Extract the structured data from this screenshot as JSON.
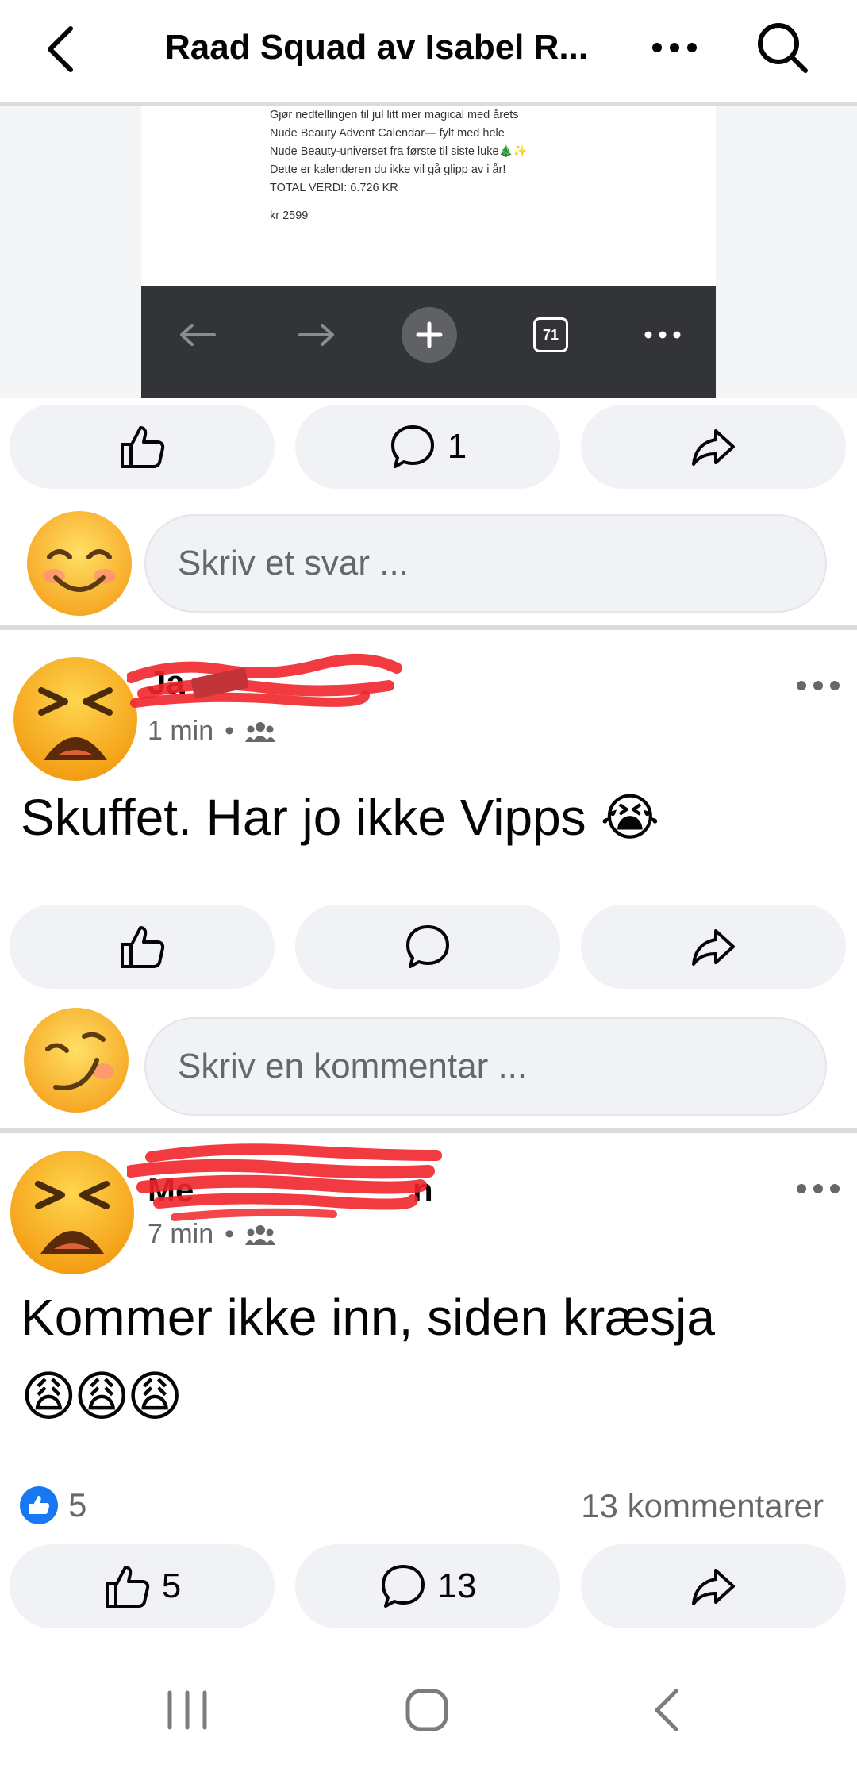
{
  "header": {
    "title": "Raad Squad av Isabel R..."
  },
  "shared_post": {
    "text_lines": [
      "Gjør nedtellingen til jul litt mer magical med årets",
      "Nude Beauty Advent Calendar— fylt med hele",
      "Nude Beauty-universet fra første til siste luke🎄✨",
      "Dette er kalenderen du ikke vil gå glipp av i år!",
      "TOTAL VERDI: 6.726 KR"
    ],
    "price": "kr 2599",
    "tab_count": "71"
  },
  "post_actions": {
    "comment_count": "1"
  },
  "reply": {
    "placeholder": "Skriv et svar ..."
  },
  "comments": [
    {
      "name_visible": "Ja",
      "time": "1 min",
      "text": "Skuffet. Har jo ikke Vipps 😭",
      "reply_placeholder": "Skriv en kommentar ..."
    },
    {
      "name_visible": "Me",
      "name_tail": "n",
      "time": "7 min",
      "text": "Kommer ikke inn, siden kræsja",
      "emojis": "😩😩😩",
      "reactions_count": "5",
      "comments_count_label": "13 kommentarer",
      "like_count": "5",
      "comment_count": "13"
    }
  ],
  "colors": {
    "like_blue": "#1877f2",
    "pill_bg": "#f0f2f5",
    "muted_text": "#65676b",
    "scribble_red": "#f0262c"
  }
}
